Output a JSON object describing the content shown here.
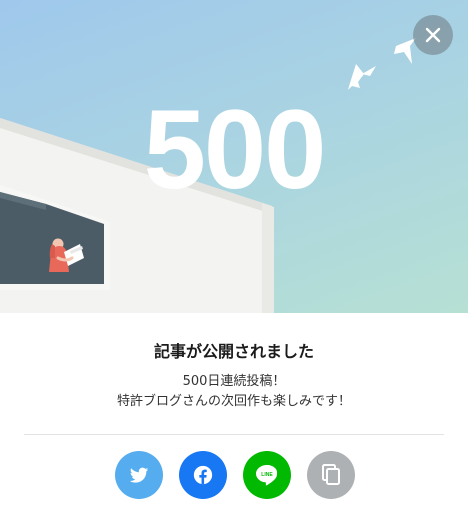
{
  "hero": {
    "count": "500",
    "close_icon": "close-icon"
  },
  "dialog": {
    "title": "記事が公開されました",
    "message_line1": "500日連続投稿！",
    "message_line2": "特許ブログさんの次回作も楽しみです！"
  },
  "share": {
    "buttons": [
      {
        "icon": "twitter-icon",
        "color": "#55acee"
      },
      {
        "icon": "facebook-icon",
        "color": "#1877f2"
      },
      {
        "icon": "line-icon",
        "label": "LINE",
        "color": "#00b900"
      },
      {
        "icon": "copy-icon",
        "color": "#aeb1b4"
      }
    ]
  }
}
